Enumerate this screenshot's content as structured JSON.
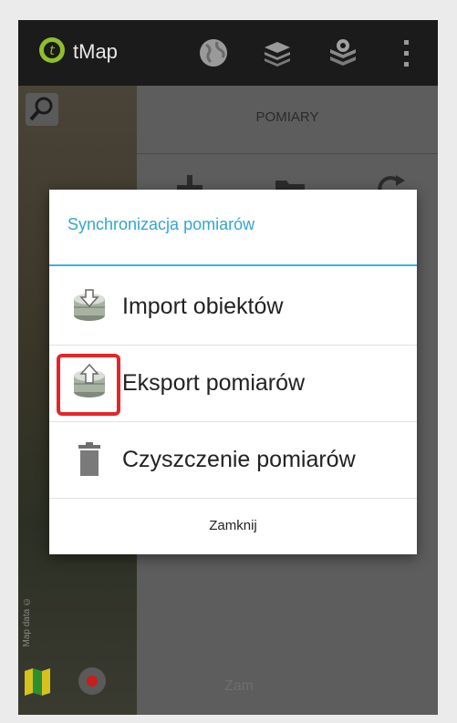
{
  "app": {
    "title": "tMap"
  },
  "panel": {
    "title": "POMIARY",
    "hint": "Zam"
  },
  "map": {
    "credit": "Map data ©"
  },
  "dialog": {
    "title": "Synchronizacja pomiarów",
    "items": [
      {
        "label": "Import obiektów",
        "icon": "database-import-icon"
      },
      {
        "label": "Eksport pomiarów",
        "icon": "database-export-icon"
      },
      {
        "label": "Czyszczenie pomiarów",
        "icon": "trash-icon"
      }
    ],
    "close_label": "Zamknij"
  },
  "colors": {
    "accent": "#33b5e5",
    "title_text": "#33a6cc",
    "highlight": "#e5252a"
  }
}
